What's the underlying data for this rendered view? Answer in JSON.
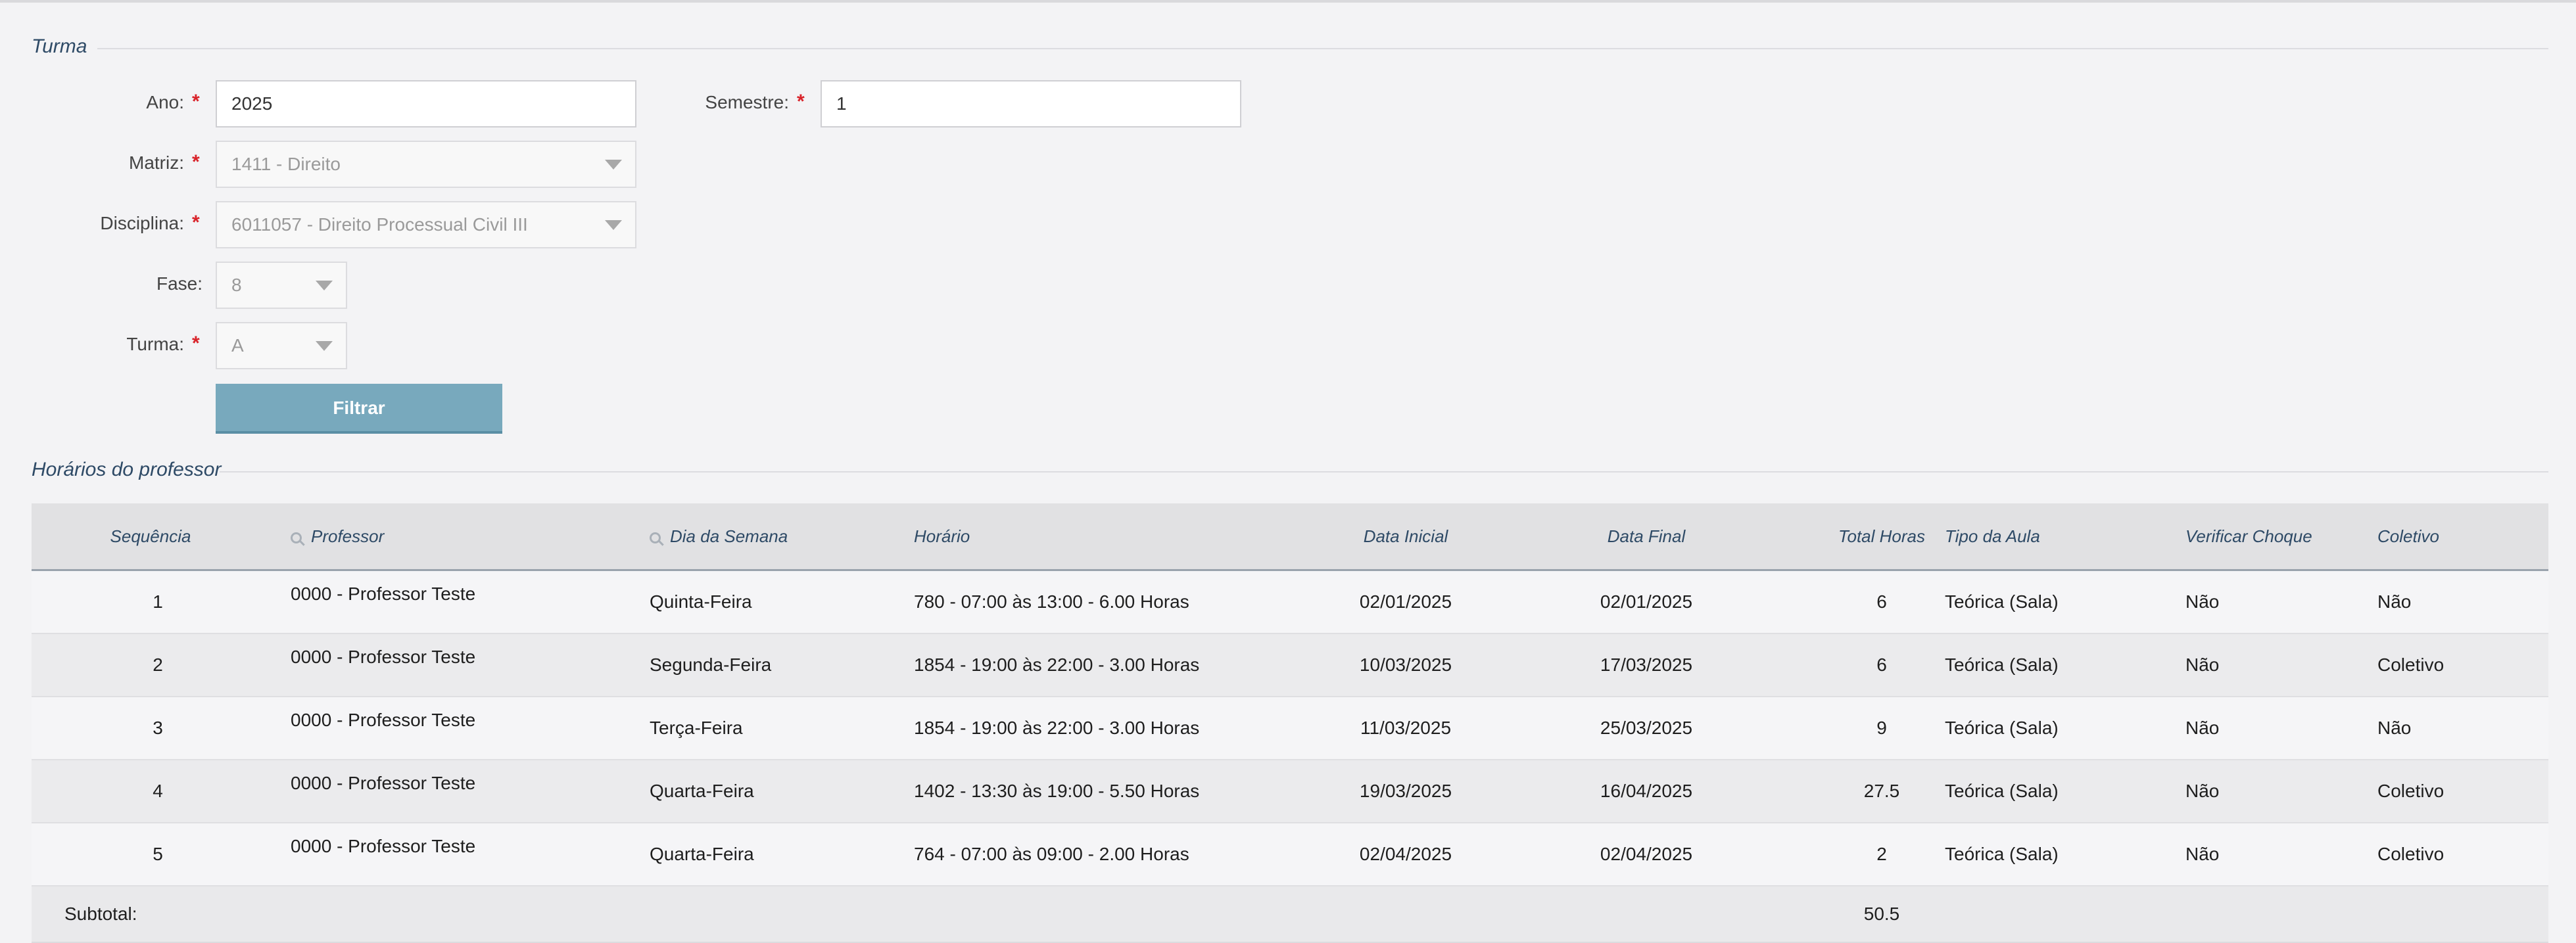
{
  "form": {
    "legend": "Turma",
    "ano": {
      "label": "Ano:",
      "value": "2025"
    },
    "semestre": {
      "label": "Semestre:",
      "value": "1"
    },
    "matriz": {
      "label": "Matriz:",
      "value": "1411 - Direito"
    },
    "disciplina": {
      "label": "Disciplina:",
      "value": "6011057 - Direito Processual Civil III"
    },
    "fase": {
      "label": "Fase:",
      "value": "8"
    },
    "turma": {
      "label": "Turma:",
      "value": "A"
    },
    "required_marker": "*",
    "filter_button": "Filtrar"
  },
  "schedule": {
    "legend": "Horários do professor",
    "columns": {
      "sequencia": "Sequência",
      "professor": "Professor",
      "dia": "Dia da Semana",
      "horario": "Horário",
      "data_inicial": "Data Inicial",
      "data_final": "Data Final",
      "total_horas": "Total Horas",
      "tipo": "Tipo da Aula",
      "verificar": "Verificar Choque",
      "coletivo": "Coletivo"
    },
    "rows": [
      {
        "seq": "1",
        "professor": "0000 - Professor Teste",
        "dia": "Quinta-Feira",
        "horario": "780 - 07:00 às 13:00 - 6.00 Horas",
        "data_inicial": "02/01/2025",
        "data_final": "02/01/2025",
        "total": "6",
        "tipo": "Teórica (Sala)",
        "verificar": "Não",
        "coletivo": "Não"
      },
      {
        "seq": "2",
        "professor": "0000 - Professor Teste",
        "dia": "Segunda-Feira",
        "horario": "1854 - 19:00 às 22:00 - 3.00 Horas",
        "data_inicial": "10/03/2025",
        "data_final": "17/03/2025",
        "total": "6",
        "tipo": "Teórica (Sala)",
        "verificar": "Não",
        "coletivo": "Coletivo"
      },
      {
        "seq": "3",
        "professor": "0000 - Professor Teste",
        "dia": "Terça-Feira",
        "horario": "1854 - 19:00 às 22:00 - 3.00 Horas",
        "data_inicial": "11/03/2025",
        "data_final": "25/03/2025",
        "total": "9",
        "tipo": "Teórica (Sala)",
        "verificar": "Não",
        "coletivo": "Não"
      },
      {
        "seq": "4",
        "professor": "0000 - Professor Teste",
        "dia": "Quarta-Feira",
        "horario": "1402 - 13:30 às 19:00 - 5.50 Horas",
        "data_inicial": "19/03/2025",
        "data_final": "16/04/2025",
        "total": "27.5",
        "tipo": "Teórica (Sala)",
        "verificar": "Não",
        "coletivo": "Coletivo"
      },
      {
        "seq": "5",
        "professor": "0000 - Professor Teste",
        "dia": "Quarta-Feira",
        "horario": "764 - 07:00 às 09:00 - 2.00 Horas",
        "data_inicial": "02/04/2025",
        "data_final": "02/04/2025",
        "total": "2",
        "tipo": "Teórica (Sala)",
        "verificar": "Não",
        "coletivo": "Coletivo"
      }
    ],
    "subtotal": {
      "label": "Subtotal:",
      "value": "50.5"
    }
  }
}
